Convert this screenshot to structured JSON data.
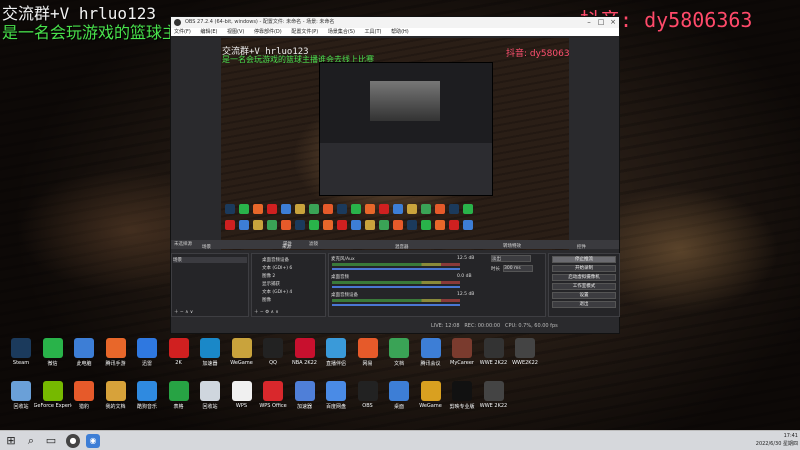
{
  "overlay": {
    "line1": "交流群+V hrluo123",
    "line2": "是一名会玩游戏的篮球主播谁会去线上比赛",
    "douyin": "抖音: dy5806363"
  },
  "obs": {
    "title": "OBS 27.2.4 (64-bit, windows) - 配置文件: 未命名 - 场景: 未命名",
    "menu": [
      "文件(F)",
      "编辑(E)",
      "视图(V)",
      "停靠部件(D)",
      "配置文件(P)",
      "场景集合(S)",
      "工具(T)",
      "帮助(H)"
    ],
    "preview": {
      "line1": "交流群+V hrluo123",
      "line2": "是一名会玩游戏的篮球主播谁会去线上比赛",
      "douyin": "抖音: dy5806363"
    },
    "context_bar": {
      "label": "未选择源",
      "properties": "属性",
      "filters": "滤镜"
    },
    "docks": {
      "scenes": "场景",
      "sources": "来源",
      "mixer": "混音器",
      "transitions": "转场特效",
      "controls": "控件"
    },
    "scenes": [
      "场景"
    ],
    "sources": [
      "桌面音频设备",
      "文本 (GDI+) 6",
      "图像 2",
      "显示捕获",
      "文本 (GDI+) 4",
      "图像"
    ],
    "mixer": [
      {
        "name": "麦克风/Aux",
        "db": "12.5 dB"
      },
      {
        "name": "桌面音频",
        "db": "0.0 dB"
      },
      {
        "name": "桌面音频设备",
        "db": "12.5 dB"
      }
    ],
    "transition": {
      "type": "淡出",
      "duration_label": "时长",
      "duration": "300 ms"
    },
    "controls": [
      "停止推流",
      "开始录制",
      "启动虚拟摄像机",
      "工作室模式",
      "设置",
      "退出"
    ],
    "status": {
      "live": "LIVE: 12:08",
      "rec": "REC: 00:00:00",
      "cpu": "CPU: 0.7%, 60.00 fps"
    }
  },
  "desktop": [
    {
      "label": "Steam",
      "color": "#1b3a5c"
    },
    {
      "label": "微信",
      "color": "#29b34a"
    },
    {
      "label": "此电脑",
      "color": "#3d7ed6"
    },
    {
      "label": "腾讯手游",
      "color": "#e8672a"
    },
    {
      "label": "迅雷",
      "color": "#2f78e0"
    },
    {
      "label": "2K",
      "color": "#d02020"
    },
    {
      "label": "加速器",
      "color": "#1a88c8"
    },
    {
      "label": "WeGame",
      "color": "#c9a33c"
    },
    {
      "label": "QQ",
      "color": "#222"
    },
    {
      "label": "NBA 2K22",
      "color": "#c8102e"
    },
    {
      "label": "直播伴侣",
      "color": "#3a9ad9"
    },
    {
      "label": "网易",
      "color": "#e65a2a"
    },
    {
      "label": "文档",
      "color": "#3aa356"
    },
    {
      "label": "腾讯会议",
      "color": "#3d7ed6"
    },
    {
      "label": "MyCareer",
      "color": "#7a3b2e"
    },
    {
      "label": "WWE 2K22",
      "color": "#333"
    },
    {
      "label": "WWE2K22",
      "color": "#444"
    },
    {
      "label": "回收站",
      "color": "#6aa0d8"
    },
    {
      "label": "GeForce Experience",
      "color": "#76b900"
    },
    {
      "label": "猎豹",
      "color": "#e65a2a"
    },
    {
      "label": "我的文档",
      "color": "#d7a23a"
    },
    {
      "label": "酷狗音乐",
      "color": "#2f8ae0"
    },
    {
      "label": "表格",
      "color": "#27a344"
    },
    {
      "label": "回收站",
      "color": "#cfd6de"
    },
    {
      "label": "WPS",
      "color": "#f0f0f0"
    },
    {
      "label": "WPS Office",
      "color": "#d9282c"
    },
    {
      "label": "加速器",
      "color": "#4f7fd8"
    },
    {
      "label": "百度网盘",
      "color": "#4a8be6"
    },
    {
      "label": "OBS",
      "color": "#222"
    },
    {
      "label": "桌面",
      "color": "#3d7ed6"
    },
    {
      "label": "WeGame",
      "color": "#d9a020"
    },
    {
      "label": "剪映专业版",
      "color": "#111"
    },
    {
      "label": "WWE 2K22",
      "color": "#444"
    }
  ],
  "taskbar": {
    "time": "17:41",
    "date": "2022/6/30 星期四"
  }
}
